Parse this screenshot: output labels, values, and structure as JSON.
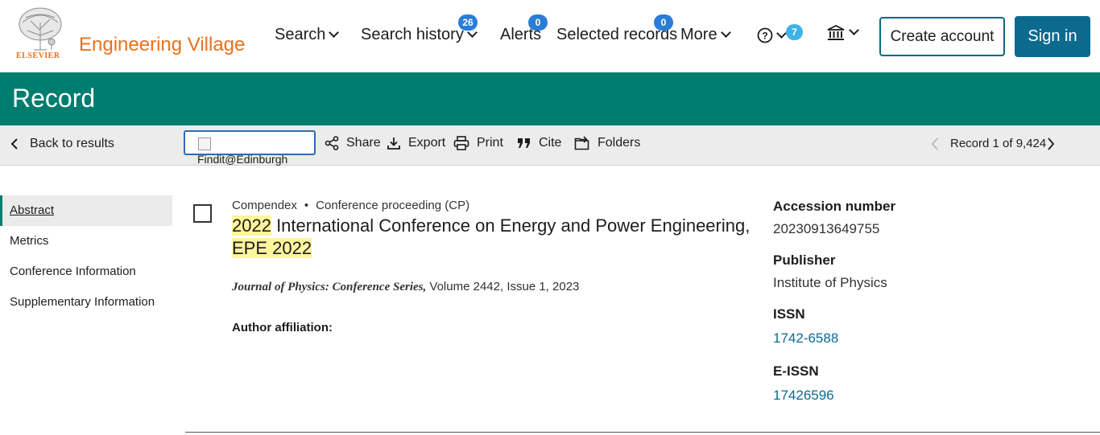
{
  "header": {
    "logo_text": "ELSEVIER",
    "brand": "Engineering Village",
    "nav": {
      "search": "Search",
      "search_history": "Search history",
      "search_history_count": "26",
      "alerts": "Alerts",
      "alerts_count": "0",
      "selected_records": "Selected records",
      "selected_records_count": "0",
      "more": "More",
      "help_count": "7"
    },
    "create_account": "Create account",
    "sign_in": "Sign in"
  },
  "banner": {
    "title": "Record"
  },
  "toolbar": {
    "back": "Back to results",
    "findit": "Findit@Edinburgh",
    "share": "Share",
    "export": "Export",
    "print": "Print",
    "cite": "Cite",
    "folders": "Folders",
    "record_position": "Record 1 of 9,424"
  },
  "sidebar": {
    "items": [
      {
        "label": "Abstract"
      },
      {
        "label": "Metrics"
      },
      {
        "label": "Conference Information"
      },
      {
        "label": "Supplementary Information"
      }
    ]
  },
  "record": {
    "database": "Compendex",
    "doc_type": "Conference proceeding (CP)",
    "title_year": "2022",
    "title_rest": " International Conference on Energy and Power Engineering, ",
    "title_acronym": "EPE 2022",
    "journal": "Journal of Physics: Conference Series,",
    "volume_issue": " Volume 2442, Issue 1, 2023",
    "author_affiliation_label": "Author affiliation:"
  },
  "details": {
    "accession_label": "Accession number",
    "accession_value": "20230913649755",
    "publisher_label": "Publisher",
    "publisher_value": "Institute of Physics",
    "issn_label": "ISSN",
    "issn_value": "1742-6588",
    "eissn_label": "E-ISSN",
    "eissn_value": "17426596"
  },
  "colors": {
    "brand_orange": "#e9711c",
    "banner_green": "#007d6e",
    "accent_blue": "#0c6a8f",
    "highlight": "#fff59d"
  }
}
